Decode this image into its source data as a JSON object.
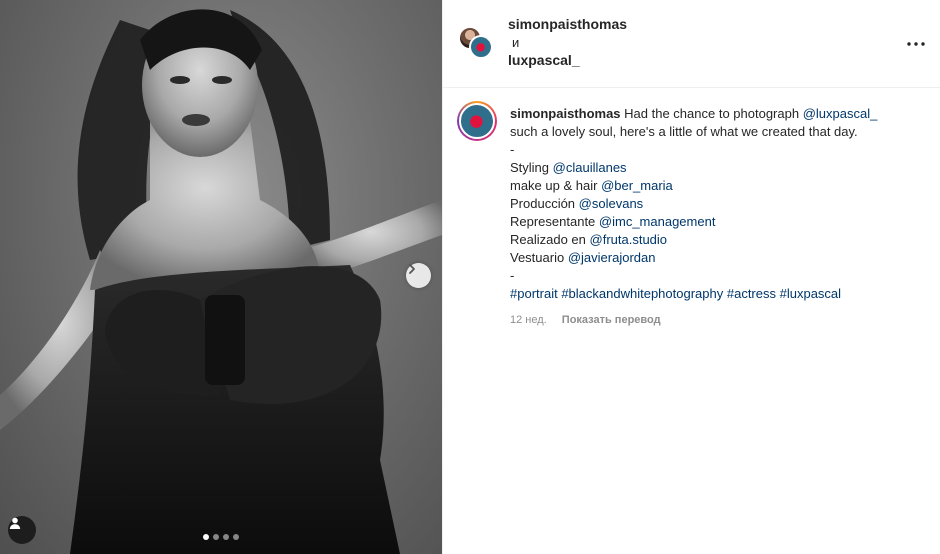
{
  "post": {
    "carousel": {
      "total_slides": 4,
      "active_slide": 1
    }
  },
  "header": {
    "user1": "simonpaisthomas",
    "and_word": "и",
    "user2": "luxpascal_"
  },
  "caption": {
    "author": "simonpaisthomas",
    "line1_text": "Had the chance to photograph",
    "line1_mention": "@luxpascal_",
    "line2_text": "such a lovely soul, here's a little of what we created that day.",
    "sep1": "-",
    "styling_label": "Styling",
    "styling_mention": "@clauillanes",
    "makeup_label": "make up & hair",
    "makeup_mention": "@ber_maria",
    "produccion_label": "Producción",
    "produccion_mention": "@solevans",
    "representante_label": "Representante",
    "representante_mention": "@imc_management",
    "realizado_label": "Realizado en",
    "realizado_mention": "@fruta.studio",
    "vestuario_label": "Vestuario",
    "vestuario_mention": "@javierajordan",
    "sep2": "-",
    "hashtags": [
      "#portrait",
      "#blackandwhitephotography",
      "#actress",
      "#luxpascal"
    ],
    "time": "12 нед.",
    "translate": "Показать перевод"
  },
  "icons": {
    "next": "chevron-right-icon",
    "user_tag": "user-tag-icon",
    "more": "more-horizontal-icon"
  },
  "colors": {
    "link": "#00376b",
    "text": "#262626",
    "muted": "#8e8e8e",
    "border": "#efefef"
  }
}
